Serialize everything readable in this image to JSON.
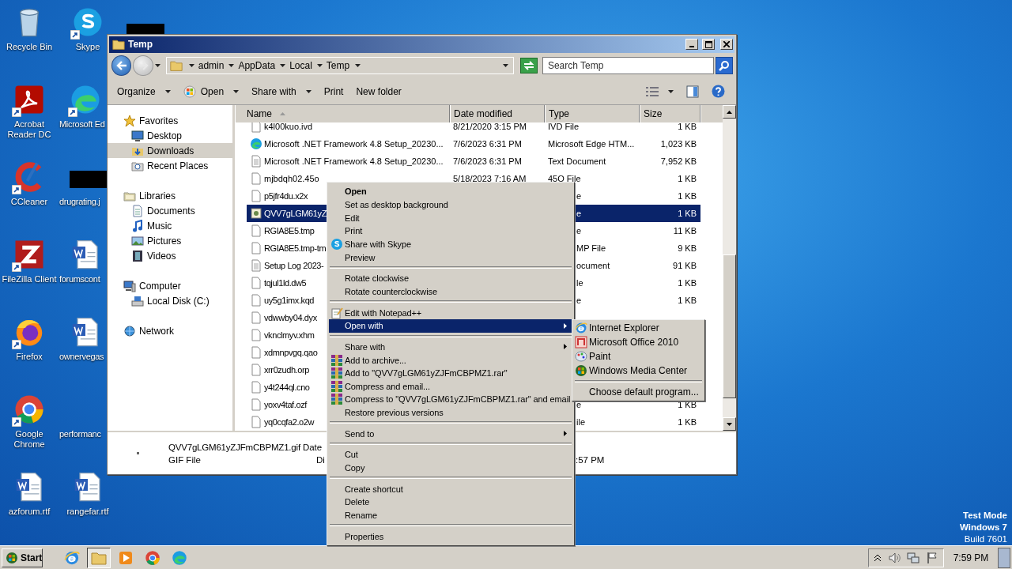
{
  "desktop": {
    "icons": [
      {
        "label": "Recycle Bin"
      },
      {
        "label": "Skype"
      },
      {
        "label": "Acrobat Reader DC"
      },
      {
        "label": "Microsoft Ed"
      },
      {
        "label": "CCleaner"
      },
      {
        "label": "drugrating.j"
      },
      {
        "label": "FileZilla Client"
      },
      {
        "label": "forumscont"
      },
      {
        "label": "Firefox"
      },
      {
        "label": "ownervegas"
      },
      {
        "label": "Google Chrome"
      },
      {
        "label": "performanc"
      },
      {
        "label": "azforum.rtf"
      },
      {
        "label": "rangefar.rtf"
      }
    ],
    "system_notice": [
      "Test Mode",
      "Windows 7",
      "Build 7601"
    ]
  },
  "window": {
    "title": "Temp",
    "address": {
      "crumbs": [
        "admin",
        "AppData",
        "Local",
        "Temp"
      ]
    },
    "search": {
      "placeholder": "Search Temp"
    },
    "toolbar": [
      {
        "label": "Organize",
        "dropdown": true
      },
      {
        "label": "Open",
        "dropdown": true
      },
      {
        "label": "Share with",
        "dropdown": true
      },
      {
        "label": "Print",
        "dropdown": false
      },
      {
        "label": "New folder",
        "dropdown": false
      }
    ],
    "sidebar": {
      "groups": [
        {
          "label": "Favorites",
          "children": [
            {
              "label": "Desktop",
              "selected": false
            },
            {
              "label": "Downloads",
              "selected": true
            },
            {
              "label": "Recent Places",
              "selected": false
            }
          ]
        },
        {
          "label": "Libraries",
          "children": [
            {
              "label": "Documents",
              "selected": false
            },
            {
              "label": "Music",
              "selected": false
            },
            {
              "label": "Pictures",
              "selected": false
            },
            {
              "label": "Videos",
              "selected": false
            }
          ]
        },
        {
          "label": "Computer",
          "children": [
            {
              "label": "Local Disk (C:)",
              "selected": false
            }
          ]
        },
        {
          "label": "Network"
        }
      ]
    },
    "table": {
      "columns": [
        "Name",
        "Date modified",
        "Type",
        "Size"
      ],
      "rows": [
        {
          "name": "k4l00kuo.ivd",
          "date": "8/21/2020 3:15 PM",
          "type": "IVD File",
          "size": "1 KB",
          "selected": false
        },
        {
          "name": "Microsoft .NET Framework 4.8 Setup_20230...",
          "date": "7/6/2023 6:31 PM",
          "type": "Microsoft Edge HTM...",
          "size": "1,023 KB",
          "selected": false
        },
        {
          "name": "Microsoft .NET Framework 4.8 Setup_20230...",
          "date": "7/6/2023 6:31 PM",
          "type": "Text Document",
          "size": "7,952 KB",
          "selected": false
        },
        {
          "name": "mjbdqh02.45o",
          "date": "5/18/2023 7:16 AM",
          "type": "45O File",
          "size": "1 KB",
          "selected": false
        },
        {
          "name": "p5jfr4du.x2x",
          "type": "e",
          "size": "1 KB",
          "selected": false
        },
        {
          "name": "QVV7gLGM61yZ",
          "type": "e",
          "size": "1 KB",
          "selected": true
        },
        {
          "name": "RGIA8E5.tmp",
          "type": "e",
          "size": "11 KB",
          "selected": false
        },
        {
          "name": "RGIA8E5.tmp-tm",
          "type": "MP File",
          "size": "9 KB",
          "selected": false
        },
        {
          "name": "Setup Log 2023-",
          "type": "ocument",
          "size": "91 KB",
          "selected": false
        },
        {
          "name": "tqjul1ld.dw5",
          "type": "le",
          "size": "1 KB",
          "selected": false
        },
        {
          "name": "uy5g1imx.kqd",
          "type": "e",
          "size": "1 KB",
          "selected": false
        },
        {
          "name": "vdwwby04.dyx",
          "selected": false
        },
        {
          "name": "vknclmyv.xhm",
          "selected": false
        },
        {
          "name": "xdmnpvgq.qao",
          "selected": false
        },
        {
          "name": "xrr0zudh.orp",
          "selected": false
        },
        {
          "name": "y4t244ql.cno",
          "selected": false
        },
        {
          "name": "yoxv4taf.ozf",
          "type": "e",
          "size": "1 KB",
          "selected": false
        },
        {
          "name": "yq0cqfa2.o2w",
          "type": "ile",
          "size": "1 KB",
          "selected": false
        }
      ]
    },
    "details": {
      "name": "QVV7gLGM61yZJFmCBPMZ1.gif",
      "name_label": "Date",
      "type": "GIF File",
      "type_label": "Di",
      "time": ":57 PM"
    }
  },
  "context_menu": {
    "items": [
      {
        "kind": "item",
        "label": "Open",
        "default": true,
        "selected": false,
        "submenu": false
      },
      {
        "kind": "item",
        "label": "Set as desktop background",
        "default": false,
        "selected": false,
        "submenu": false
      },
      {
        "kind": "item",
        "label": "Edit",
        "default": false,
        "selected": false,
        "submenu": false
      },
      {
        "kind": "item",
        "label": "Print",
        "default": false,
        "selected": false,
        "submenu": false
      },
      {
        "kind": "item",
        "label": "Share with Skype",
        "default": false,
        "selected": false,
        "submenu": false
      },
      {
        "kind": "item",
        "label": "Preview",
        "default": false,
        "selected": false,
        "submenu": false
      },
      {
        "kind": "separator"
      },
      {
        "kind": "item",
        "label": "Rotate clockwise",
        "default": false,
        "selected": false,
        "submenu": false
      },
      {
        "kind": "item",
        "label": "Rotate counterclockwise",
        "default": false,
        "selected": false,
        "submenu": false
      },
      {
        "kind": "separator"
      },
      {
        "kind": "item",
        "label": "Edit with Notepad++",
        "default": false,
        "selected": false,
        "submenu": false
      },
      {
        "kind": "item",
        "label": "Open with",
        "default": false,
        "selected": true,
        "submenu": true
      },
      {
        "kind": "separator"
      },
      {
        "kind": "item",
        "label": "Share with",
        "default": false,
        "selected": false,
        "submenu": true
      },
      {
        "kind": "item",
        "label": "Add to archive...",
        "default": false,
        "selected": false,
        "submenu": false
      },
      {
        "kind": "item",
        "label": "Add to \"QVV7gLGM61yZJFmCBPMZ1.rar\"",
        "default": false,
        "selected": false,
        "submenu": false
      },
      {
        "kind": "item",
        "label": "Compress and email...",
        "default": false,
        "selected": false,
        "submenu": false
      },
      {
        "kind": "item",
        "label": "Compress to \"QVV7gLGM61yZJFmCBPMZ1.rar\" and email",
        "default": false,
        "selected": false,
        "submenu": false
      },
      {
        "kind": "item",
        "label": "Restore previous versions",
        "default": false,
        "selected": false,
        "submenu": false
      },
      {
        "kind": "separator"
      },
      {
        "kind": "item",
        "label": "Send to",
        "default": false,
        "selected": false,
        "submenu": true
      },
      {
        "kind": "separator"
      },
      {
        "kind": "item",
        "label": "Cut",
        "default": false,
        "selected": false,
        "submenu": false
      },
      {
        "kind": "item",
        "label": "Copy",
        "default": false,
        "selected": false,
        "submenu": false
      },
      {
        "kind": "separator"
      },
      {
        "kind": "item",
        "label": "Create shortcut",
        "default": false,
        "selected": false,
        "submenu": false
      },
      {
        "kind": "item",
        "label": "Delete",
        "default": false,
        "selected": false,
        "submenu": false
      },
      {
        "kind": "item",
        "label": "Rename",
        "default": false,
        "selected": false,
        "submenu": false
      },
      {
        "kind": "separator"
      },
      {
        "kind": "item",
        "label": "Properties",
        "default": false,
        "selected": false,
        "submenu": false
      }
    ]
  },
  "submenu": {
    "items": [
      {
        "kind": "item",
        "label": "Internet Explorer"
      },
      {
        "kind": "item",
        "label": "Microsoft Office 2010"
      },
      {
        "kind": "item",
        "label": "Paint"
      },
      {
        "kind": "item",
        "label": "Windows Media Center"
      },
      {
        "kind": "separator"
      },
      {
        "kind": "item",
        "label": "Choose default program..."
      }
    ]
  },
  "taskbar": {
    "start_label": "Start",
    "pinned": [
      {
        "active": false
      },
      {
        "active": true
      },
      {
        "active": false
      },
      {
        "active": false
      },
      {
        "active": false
      }
    ],
    "clock": "7:59 PM"
  }
}
